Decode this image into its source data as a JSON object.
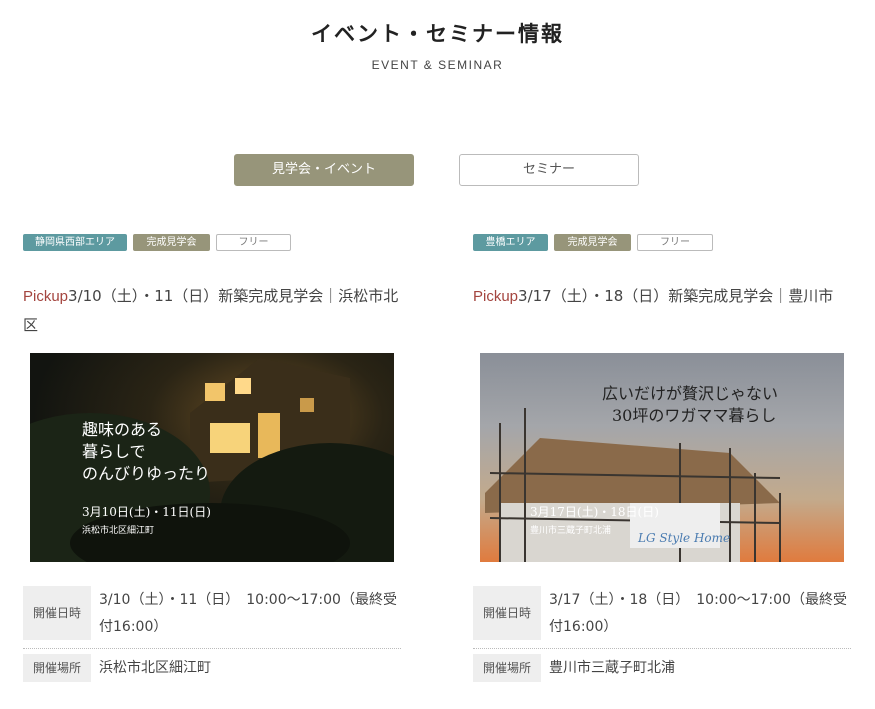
{
  "header": {
    "title": "イベント・セミナー情報",
    "subtitle": "EVENT & SEMINAR"
  },
  "tabs": [
    {
      "label": "見学会・イベント",
      "active": true
    },
    {
      "label": "セミナー",
      "active": false
    }
  ],
  "colors": {
    "olive": "#97957a",
    "teal": "#5d9aa0",
    "pickup": "#a4453f"
  },
  "cards": [
    {
      "tags": [
        "静岡県西部エリア",
        "完成見学会",
        "フリー"
      ],
      "pickup": "Pickup",
      "title": "3/10（土）・11（日）新築完成見学会｜浜松市北区",
      "image": {
        "main_line1": "趣味のある",
        "main_line2": "暮らしで",
        "main_line3": "のんびりゆったり",
        "date": "3月10日(土)・11日(日)",
        "place": "浜松市北区細江町"
      },
      "date_label": "開催日時",
      "date_value": "3/10（土）・11（日）　10:00〜17:00（最終受付16:00）",
      "place_label": "開催場所",
      "place_value": "浜松市北区細江町"
    },
    {
      "tags": [
        "豊橋エリア",
        "完成見学会",
        "フリー"
      ],
      "pickup": "Pickup",
      "title": "3/17（土）・18（日）新築完成見学会｜豊川市",
      "image": {
        "main_line1": "広いだけが贅沢じゃない",
        "main_line2": "30坪のワガママ暮らし",
        "date": "3月17日(土)・18日(日)",
        "place": "豊川市三蔵子町北浦",
        "logo": "LG Style Home"
      },
      "date_label": "開催日時",
      "date_value": "3/17（土）・18（日）　10:00〜17:00（最終受付16:00）",
      "place_label": "開催場所",
      "place_value": "豊川市三蔵子町北浦"
    }
  ]
}
